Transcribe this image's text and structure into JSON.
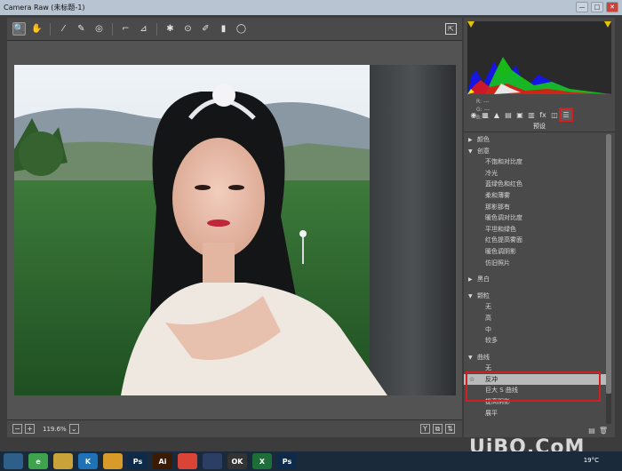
{
  "window": {
    "title": "Camera Raw (未标题-1)",
    "minimize": "—",
    "maximize": "□",
    "close": "✕"
  },
  "toolbar": {
    "tools": [
      {
        "name": "zoom-tool",
        "glyph": "🔍"
      },
      {
        "name": "hand-tool",
        "glyph": "✋"
      },
      {
        "name": "white-balance-tool",
        "glyph": "⁄"
      },
      {
        "name": "color-sampler-tool",
        "glyph": "✎"
      },
      {
        "name": "targeted-adjust-tool",
        "glyph": "◎"
      },
      {
        "name": "crop-tool",
        "glyph": "⌐"
      },
      {
        "name": "straighten-tool",
        "glyph": "⊿"
      },
      {
        "name": "spot-removal-tool",
        "glyph": "✱"
      },
      {
        "name": "red-eye-tool",
        "glyph": "⊙"
      },
      {
        "name": "adjustment-brush-tool",
        "glyph": "✐"
      },
      {
        "name": "graduated-filter-tool",
        "glyph": "▮"
      },
      {
        "name": "radial-filter-tool",
        "glyph": "◯"
      }
    ],
    "export_icon": "⇱"
  },
  "bottombar": {
    "zoom_out": "−",
    "zoom_in": "+",
    "zoom_level": "119.6%",
    "zoom_dropdown": "⌄",
    "y_button": "Y",
    "view_buttons": [
      "⧉",
      "⇅"
    ]
  },
  "histogram": {
    "r_label": "R:",
    "g_label": "G:",
    "b_label": "B:",
    "r_value": "---",
    "g_value": "---",
    "b_value": "---"
  },
  "panel_tabs": [
    "◉",
    "▦",
    "▲",
    "▤",
    "▣",
    "▥",
    "fx",
    "◫",
    "☰"
  ],
  "panel_title": "预设",
  "presets": [
    {
      "label": "颜色",
      "type": "group",
      "tri": "▶"
    },
    {
      "label": "创意",
      "type": "group",
      "tri": "▼"
    },
    {
      "label": "不饱和对比度",
      "type": "item"
    },
    {
      "label": "冷光",
      "type": "item"
    },
    {
      "label": "蓝绿色和红色",
      "type": "item"
    },
    {
      "label": "柔和薄雾",
      "type": "item"
    },
    {
      "label": "那影那有",
      "type": "item"
    },
    {
      "label": "暖色调对比度",
      "type": "item"
    },
    {
      "label": "平坦和绿色",
      "type": "item"
    },
    {
      "label": "红色提高雾面",
      "type": "item"
    },
    {
      "label": "暖色调阴影",
      "type": "item"
    },
    {
      "label": "仿旧照片",
      "type": "item"
    },
    {
      "label": "",
      "type": "spacer"
    },
    {
      "label": "黑白",
      "type": "group",
      "tri": "▶"
    },
    {
      "label": "",
      "type": "spacer"
    },
    {
      "label": "颗粒",
      "type": "group",
      "tri": "▼"
    },
    {
      "label": "无",
      "type": "item"
    },
    {
      "label": "高",
      "type": "item"
    },
    {
      "label": "中",
      "type": "item"
    },
    {
      "label": "较多",
      "type": "item"
    },
    {
      "label": "",
      "type": "spacer"
    },
    {
      "label": "曲线",
      "type": "group",
      "tri": "▼"
    },
    {
      "label": "无",
      "type": "item"
    },
    {
      "label": "反冲",
      "type": "selected",
      "star": "☆"
    },
    {
      "label": "巨大 S 曲线",
      "type": "item"
    },
    {
      "label": "提高阴影",
      "type": "item"
    },
    {
      "label": "展平",
      "type": "item"
    }
  ],
  "panel_bottom": [
    "▤",
    "🗑"
  ],
  "taskbar": {
    "apps": [
      {
        "name": "start-button",
        "label": "",
        "color": "#2d5f8a"
      },
      {
        "name": "app-360",
        "label": "e",
        "color": "#3fa34d"
      },
      {
        "name": "app-folder",
        "label": "",
        "color": "#c9a23a"
      },
      {
        "name": "app-k",
        "label": "K",
        "color": "#1e73b8"
      },
      {
        "name": "app-files",
        "label": "",
        "color": "#d89b2a"
      },
      {
        "name": "app-ps1",
        "label": "Ps",
        "color": "#0d2a4a"
      },
      {
        "name": "app-ai",
        "label": "Ai",
        "color": "#3a1a00"
      },
      {
        "name": "app-chrome",
        "label": "",
        "color": "#d94437"
      },
      {
        "name": "app-c4d",
        "label": "",
        "color": "#2a3f63"
      },
      {
        "name": "app-ok",
        "label": "OK",
        "color": "#333"
      },
      {
        "name": "app-excel",
        "label": "X",
        "color": "#1e6e3a"
      },
      {
        "name": "app-ps2",
        "label": "Ps",
        "color": "#0d2a4a"
      }
    ],
    "temperature": "19°C"
  },
  "watermark": "UiBQ.CoM"
}
